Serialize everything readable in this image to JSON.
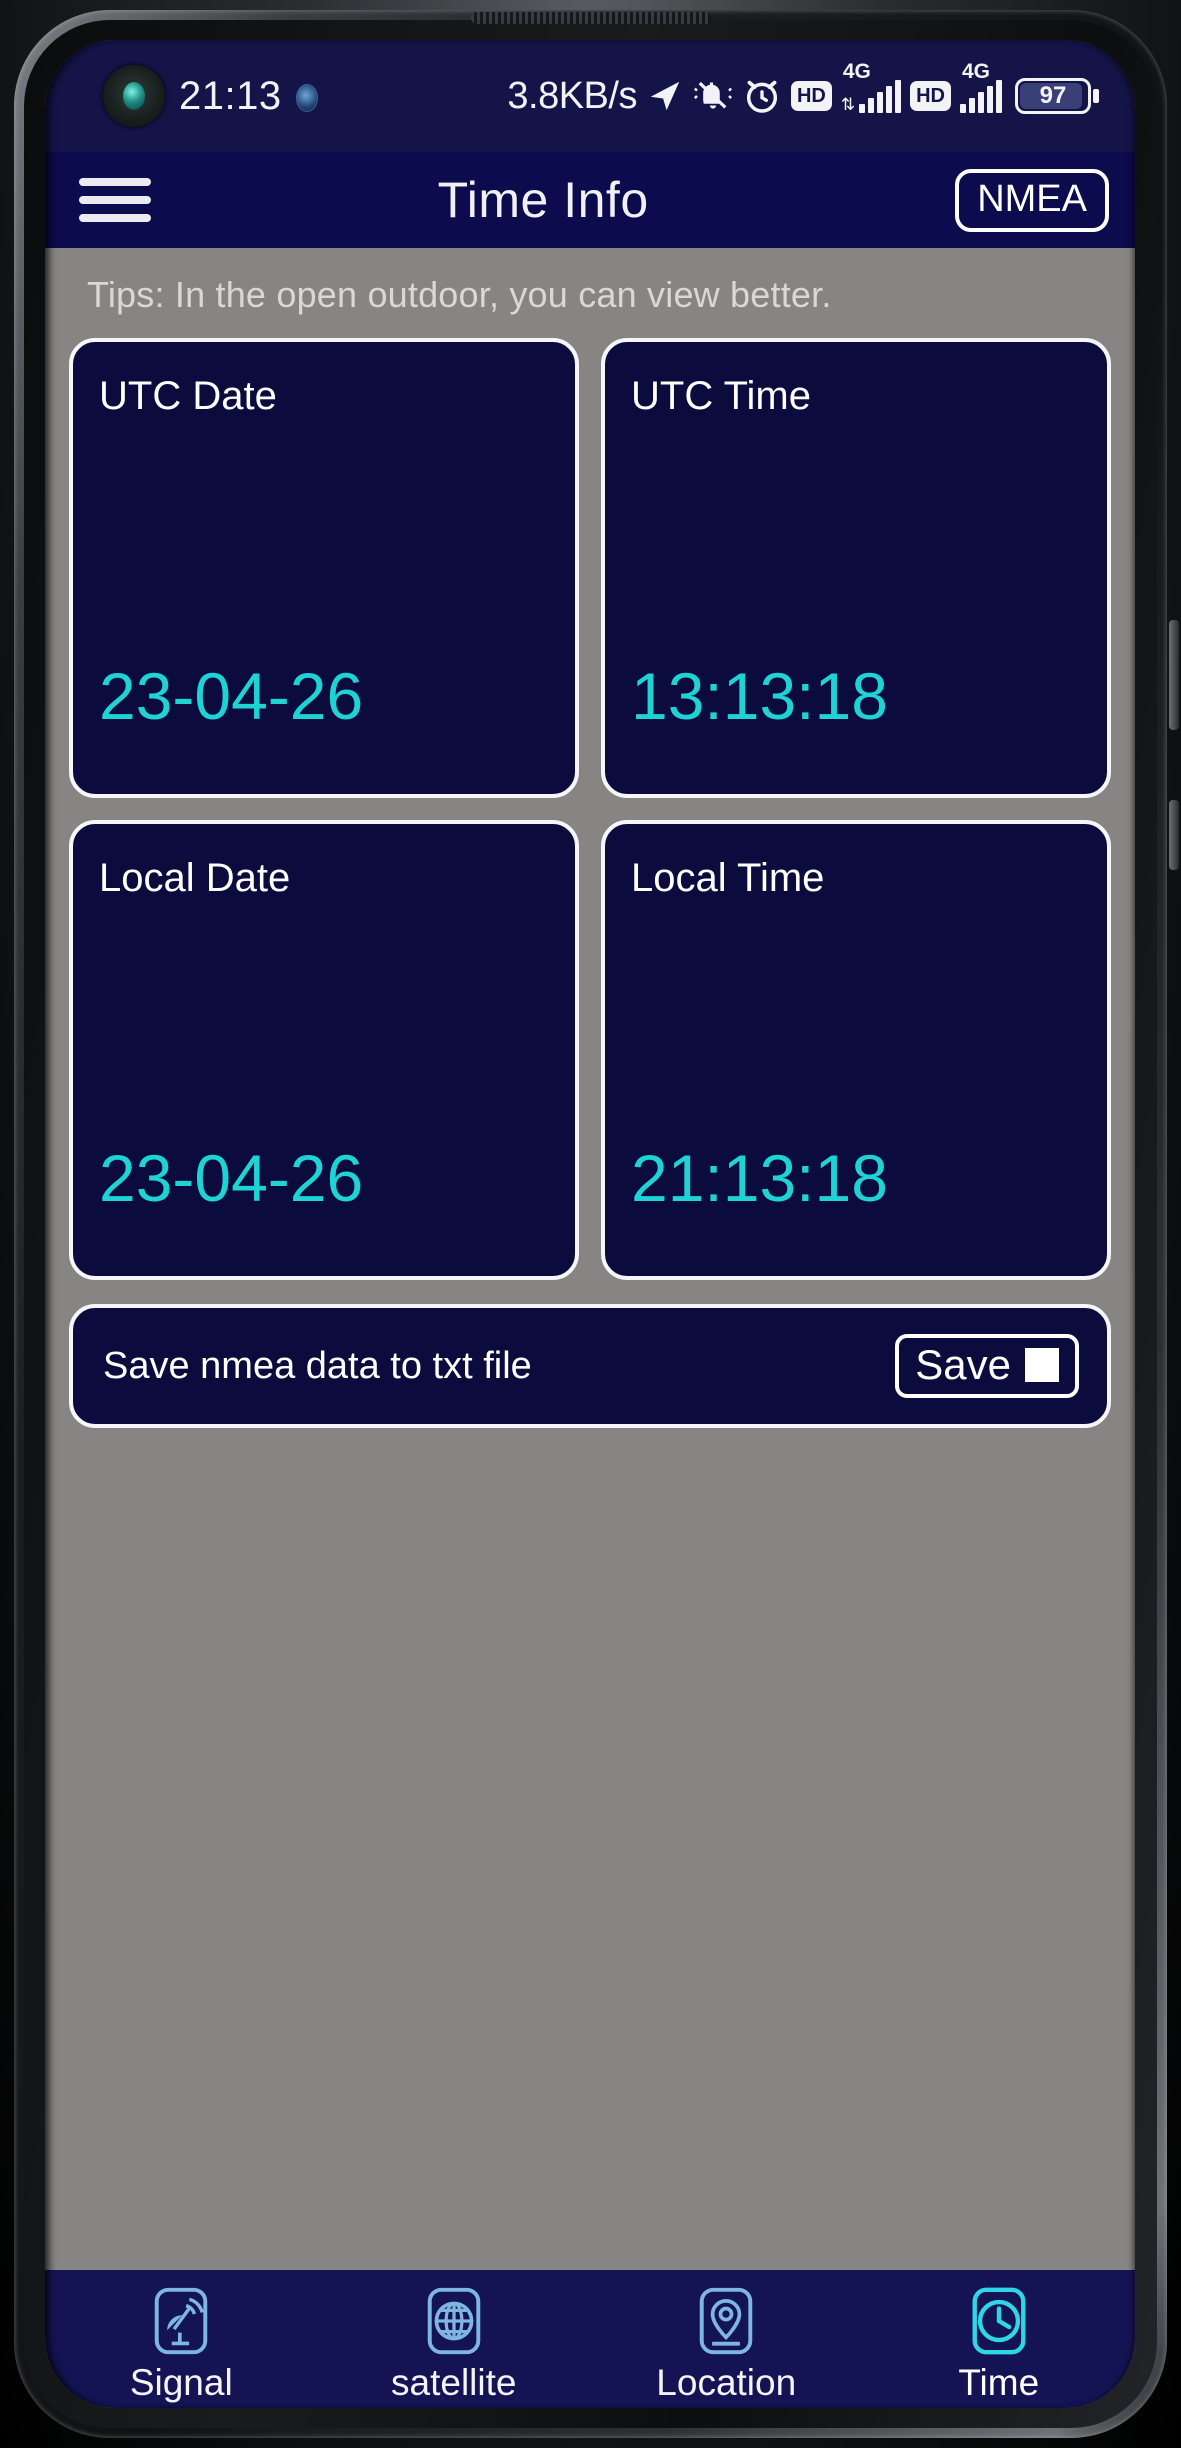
{
  "status_bar": {
    "clock": "21:13",
    "camera_icon": "front-camera-lens",
    "globe_icon": "globe-badge-icon",
    "net_rate": "3.8KB/s",
    "icons": [
      "navigation-arrow-icon",
      "bell-muted-icon",
      "alarm-clock-icon",
      "hd-badge-icon",
      "4g-signal-icon",
      "hd-badge-icon",
      "4g-signal-icon"
    ],
    "hd_label": "HD",
    "net_label": "4G",
    "battery_level": "97",
    "battery_icon": "battery-icon"
  },
  "app_bar": {
    "menu_icon": "hamburger-menu-icon",
    "title": "Time Info",
    "nmea_label": "NMEA"
  },
  "tips": "Tips: In the open outdoor, you can view better.",
  "cards": [
    {
      "label": "UTC Date",
      "value": "23-04-26"
    },
    {
      "label": "UTC Time",
      "value": "13:13:18"
    },
    {
      "label": "Local Date",
      "value": "23-04-26"
    },
    {
      "label": "Local Time",
      "value": "21:13:18"
    }
  ],
  "save_row": {
    "label": "Save nmea data to txt file",
    "button_label": "Save",
    "checkbox_checked": true
  },
  "bottom_nav": {
    "items": [
      {
        "label": "Signal",
        "icon": "satellite-dish-icon",
        "active": false
      },
      {
        "label": "satellite",
        "icon": "globe-grid-icon",
        "active": false
      },
      {
        "label": "Location",
        "icon": "map-pin-icon",
        "active": false
      },
      {
        "label": "Time",
        "icon": "clock-icon",
        "active": true
      }
    ]
  },
  "colors": {
    "accent_cyan": "#1ed3d3",
    "card_bg": "#0b0b3e",
    "app_bar_bg": "#0b0b4d",
    "status_bar_bg": "#141448",
    "nav_bg": "#141455",
    "body_bg": "#878584",
    "nav_icon": "#7fb6e0",
    "nav_icon_active": "#2fd6e8"
  }
}
